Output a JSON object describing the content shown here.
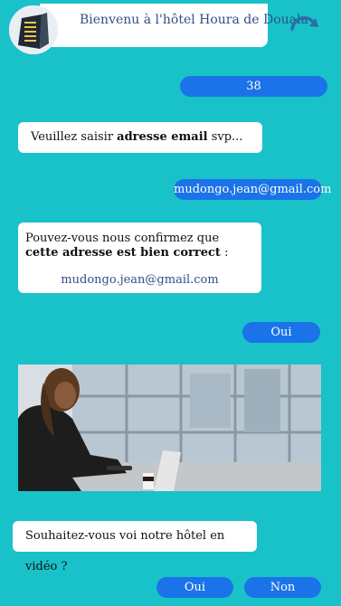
{
  "header": {
    "title": "Bienvenu à l'hôtel Houra de Douala",
    "logo_icon": "hotel-building-icon",
    "refresh_icon": "redo-arrow-icon"
  },
  "messages": {
    "user_number": "38",
    "ask_email": {
      "prefix": "Veuillez saisir ",
      "bold": "adresse email",
      "suffix": " svp..."
    },
    "user_email": "mudongo.jean@gmail.com",
    "confirm": {
      "prefix": "Pouvez-vous nous confirmez que ",
      "bold": "cette adresse est bien correct",
      "suffix": " :",
      "email": "mudongo.jean@gmail.com"
    },
    "user_yes": "Oui",
    "video_question": "Souhaitez-vous voi notre hôtel en vidéo ?"
  },
  "actions": {
    "yes": "Oui",
    "no": "Non"
  },
  "colors": {
    "background": "#19c2c9",
    "accent": "#1a73e8",
    "title": "#2f4f88"
  }
}
